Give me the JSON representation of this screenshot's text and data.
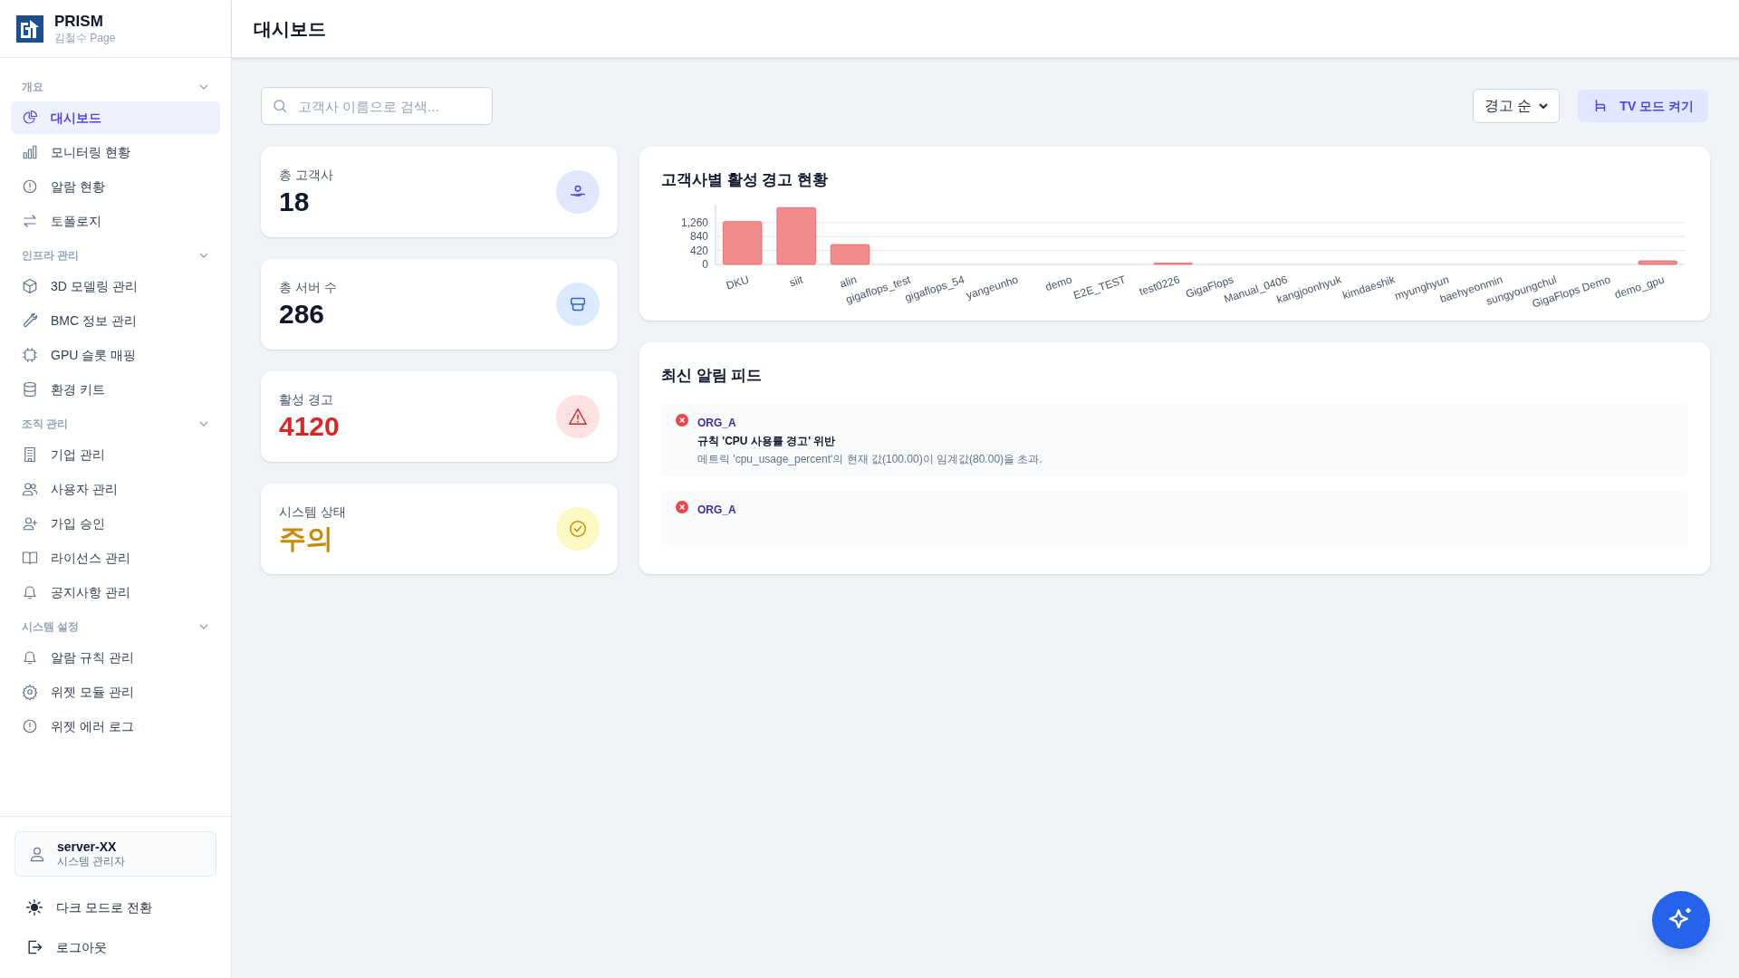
{
  "brand": {
    "name": "PRISM",
    "subtitle": "김철수 Page"
  },
  "sidebar": {
    "sections": [
      {
        "title": "개요",
        "expanded": true,
        "items": [
          {
            "label": "대시보드",
            "selected": true
          },
          {
            "label": "모니터링 현황",
            "selected": false
          },
          {
            "label": "알람 현황",
            "selected": false
          },
          {
            "label": "토폴로지",
            "selected": false
          }
        ]
      },
      {
        "title": "인프라 관리",
        "expanded": true,
        "items": [
          {
            "label": "3D 모델링 관리",
            "selected": false
          },
          {
            "label": "BMC 정보 관리",
            "selected": false
          },
          {
            "label": "GPU 슬롯 매핑",
            "selected": false
          },
          {
            "label": "환경 키트",
            "selected": false
          }
        ]
      },
      {
        "title": "조직 관리",
        "expanded": true,
        "items": [
          {
            "label": "기업 관리",
            "selected": false
          },
          {
            "label": "사용자 관리",
            "selected": false
          },
          {
            "label": "가입 승인",
            "selected": false
          },
          {
            "label": "라이선스 관리",
            "selected": false
          },
          {
            "label": "공지사항 관리",
            "selected": false
          }
        ]
      },
      {
        "title": "시스템 설정",
        "expanded": true,
        "items": [
          {
            "label": "알람 규칙 관리",
            "selected": false
          },
          {
            "label": "위젯 모듈 관리",
            "selected": false
          },
          {
            "label": "위젯 에러 로그",
            "selected": false
          }
        ]
      }
    ],
    "user": {
      "name": "server-XX",
      "role": "시스템 관리자"
    },
    "footer_items": [
      "다크 모드로 전환",
      "로그아웃"
    ]
  },
  "header": {
    "title": "대시보드"
  },
  "search": {
    "placeholder": "고객사 이름으로 검색..."
  },
  "sort_select": {
    "value": "경고 순"
  },
  "tv_button": {
    "label": "TV 모드 켜기"
  },
  "stats": [
    {
      "label": "총 고객사",
      "value": "18",
      "kind": "customers"
    },
    {
      "label": "총 서버 수",
      "value": "286",
      "kind": "servers"
    },
    {
      "label": "활성 경고",
      "value": "4120",
      "kind": "alerts"
    },
    {
      "label": "시스템 상태",
      "value": "주의",
      "kind": "status"
    }
  ],
  "chart_card": {
    "title": "고객사별 활성 경고 현황",
    "chart_data": {
      "type": "bar",
      "categories": [
        "DKU",
        "siit",
        "alin",
        "gigaflops_test",
        "gigaflops_54",
        "yangeunho",
        "demo",
        "E2E_TEST",
        "test0226",
        "GigaFlops",
        "Manual_0406",
        "kangjoonhyuk",
        "kimdaeshik",
        "myunghyun",
        "baehyeonmin",
        "sungyoungchul",
        "GigaFlops Demo",
        "demo_gpu"
      ],
      "series": [
        {
          "color": "#f28b8b",
          "values": [
            1290,
            1710,
            600,
            0,
            0,
            0,
            0,
            0,
            20,
            0,
            0,
            0,
            0,
            0,
            0,
            0,
            0,
            110
          ]
        }
      ],
      "ylim": [
        0,
        1800
      ],
      "grid": true,
      "yticks": [
        {
          "value": 0,
          "label": "0"
        },
        {
          "value": 420,
          "label": "420"
        },
        {
          "value": 840,
          "label": "840"
        },
        {
          "value": 1260,
          "label": "1,260"
        }
      ]
    }
  },
  "feed": {
    "title": "최신 알림 피드",
    "items": [
      {
        "org": "ORG_A",
        "title": "규칙 'CPU 사용률 경고' 위반",
        "message": "메트릭 'cpu_usage_percent'의 현재 값(100.00)이 임계값(80.00)을 초과."
      },
      {
        "org": "ORG_A"
      }
    ]
  }
}
